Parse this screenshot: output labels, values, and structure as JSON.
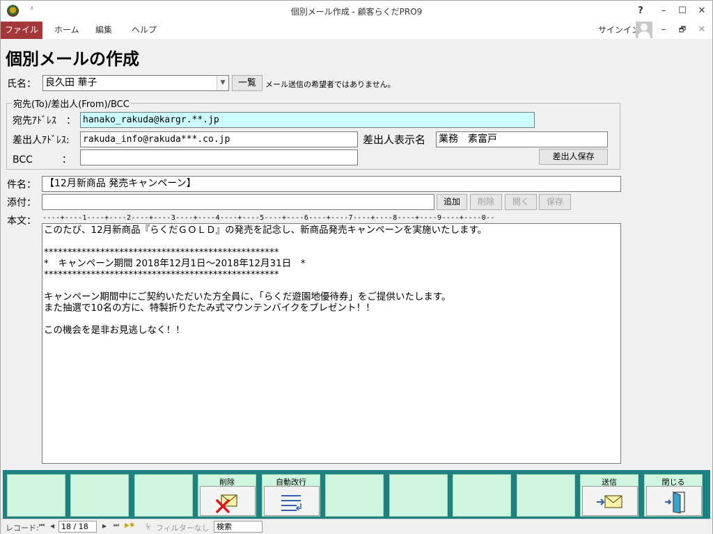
{
  "window": {
    "title": "個別メール作成 - 顧客らくだPRO9",
    "qat": "⩡",
    "help": "?",
    "minimize": "–",
    "maximize": "☐",
    "close": "✕"
  },
  "menu": {
    "file": "ファイル",
    "home": "ホーム",
    "edit": "編集",
    "help": "ヘルプ",
    "signin": "サインイン",
    "restore": "🗗",
    "sub_minimize": "–",
    "sub_close": "✕"
  },
  "form": {
    "title": "個別メールの作成",
    "name_label": "氏名：",
    "name_value": "良久田 華子",
    "list_button": "一覧",
    "notice": "メール送信の希望者ではありません。",
    "group_title": "宛先(To)/差出人(From)/BCC",
    "to_label": "宛先ｱﾄﾞﾚｽ　：",
    "to_value": "hanako_rakuda@kargr.**.jp",
    "from_label": "差出人ｱﾄﾞﾚｽ:",
    "from_value": "rakuda_info@rakuda***.co.jp",
    "sender_name_label": "差出人表示名",
    "sender_name_value": "業務　素富戸",
    "bcc_label": "BCC　　　：",
    "bcc_value": "",
    "save_sender_button": "差出人保存",
    "subject_label": "件名：",
    "subject_value": "【12月新商品 発売キャンペーン】",
    "attach_label": "添付：",
    "attach_value": "",
    "add_button": "追加",
    "delete_button": "削除",
    "open_button": "開く",
    "save_button": "保存",
    "body_label": "本文：",
    "ruler": "----+----1----+----2----+----3----+----4----+----5----+----6----+----7----+----8----+----9----+----0--",
    "body_lines": [
      "このたび、12月新商品『らくだＧＯＬＤ』の発売を記念し、新商品発売キャンペーンを実施いたします。",
      "",
      "**************************************************",
      "*　キャンペーン期間 2018年12月1日～2018年12月31日　*",
      "**************************************************",
      "",
      "キャンペーン期間中にご契約いただいた方全員に、「らくだ遊園地優待券」をご提供いたします。",
      "また抽選で10名の方に、特製折りたたみ式マウンテンバイクをプレゼント！！",
      "",
      "この機会を是非お見逃しなく！！"
    ]
  },
  "footer": {
    "delete_label": "削除",
    "autowrap_label": "自動改行",
    "send_label": "送信",
    "close_label": "閉じる"
  },
  "status": {
    "record_label": "レコード:",
    "first": "⏮",
    "prev": "◀",
    "record_value": "18 / 18",
    "next": "▶",
    "last": "⏭",
    "new": "▶✱",
    "filter": "フィルターなし",
    "search": "検索"
  },
  "colors": {
    "file_tab": "#a4373a",
    "band": "#1f8080",
    "tile": "#cff6df",
    "highlight_field": "#ccffff"
  }
}
